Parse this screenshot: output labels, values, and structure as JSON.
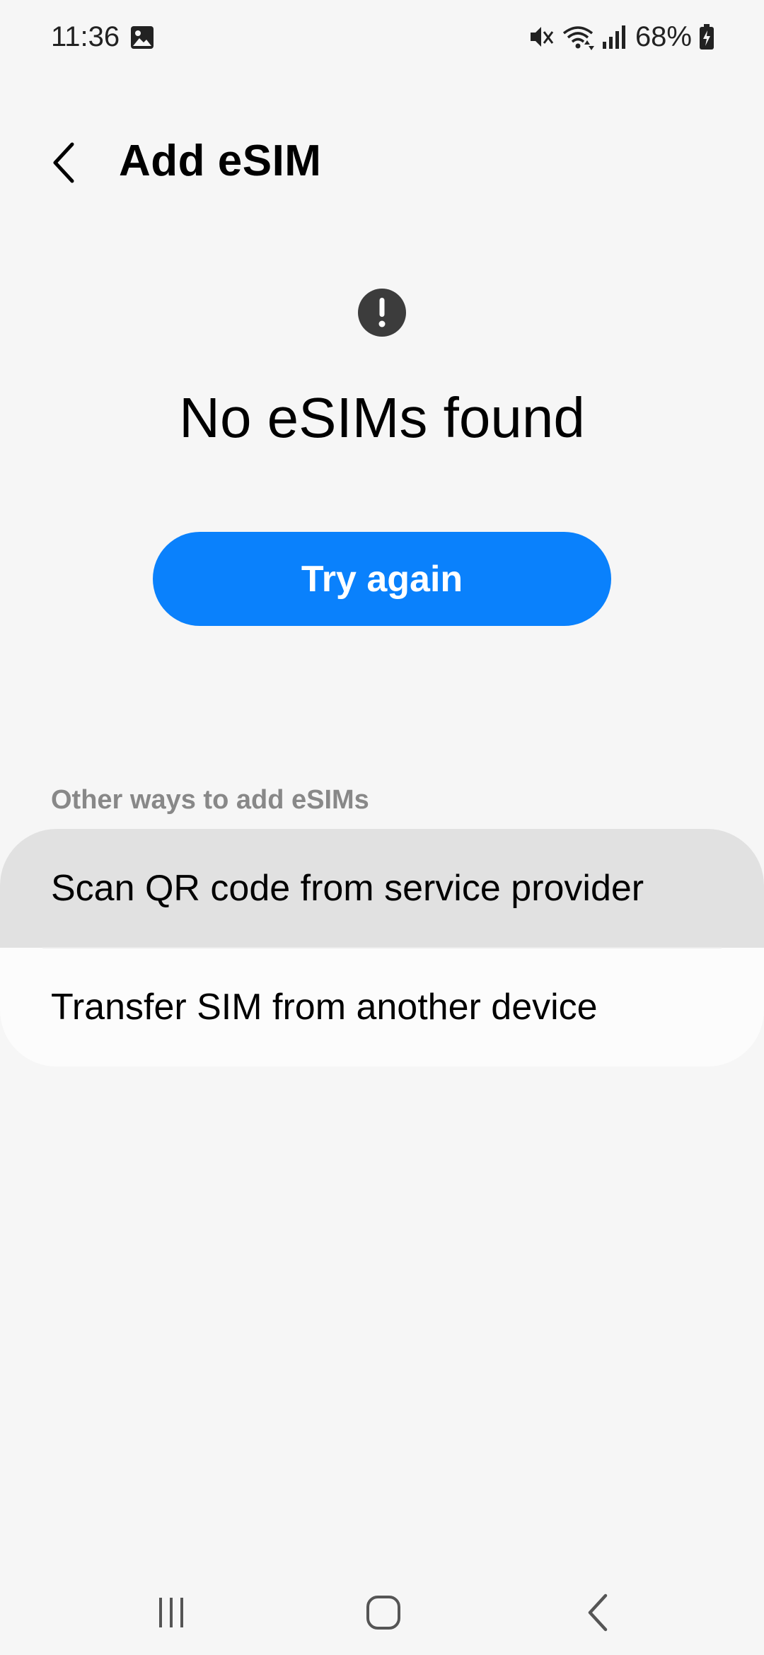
{
  "status_bar": {
    "time": "11:36",
    "battery_percent": "68%",
    "icons": [
      "gallery-icon",
      "mute-icon",
      "wifi-icon",
      "signal-icon",
      "battery-charging-icon"
    ]
  },
  "app_bar": {
    "title": "Add eSIM",
    "back_icon": "chevron-left-icon"
  },
  "empty_state": {
    "icon": "alert-circle-icon",
    "title": "No eSIMs found",
    "try_again_label": "Try again"
  },
  "other_ways": {
    "header": "Other ways to add eSIMs",
    "items": [
      {
        "label": "Scan QR code from service provider",
        "pressed": true
      },
      {
        "label": "Transfer SIM from another device",
        "pressed": false
      }
    ]
  },
  "nav_bar": {
    "icons": [
      "recents-icon",
      "home-icon",
      "back-icon"
    ]
  },
  "colors": {
    "accent": "#0a81fc",
    "background": "#f6f6f6",
    "card": "#fcfcfc",
    "pressed": "#e1e1e1",
    "section_header": "#888888"
  }
}
